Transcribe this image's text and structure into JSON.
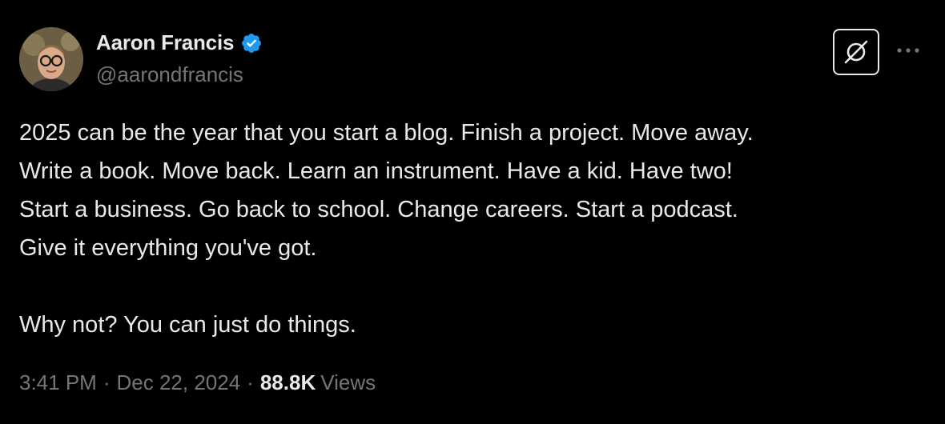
{
  "author": {
    "display_name": "Aaron Francis",
    "handle": "@aarondfrancis",
    "verified": true,
    "verified_color": "#1d9bf0"
  },
  "actions": {
    "grok_icon": "grok-icon",
    "more_icon": "more-horizontal-icon"
  },
  "tweet": {
    "lines": [
      "2025 can be the year that you start a blog. Finish a project. Move away.",
      "Write a book. Move back. Learn an instrument. Have a kid. Have two!",
      "Start a business. Go back to school. Change careers. Start a podcast.",
      "Give it everything you've got.",
      "Why not? You can just do things."
    ]
  },
  "meta": {
    "time": "3:41 PM",
    "separator": "·",
    "date": "Dec 22, 2024",
    "views_count": "88.8K",
    "views_label": "Views"
  },
  "colors": {
    "background": "#000000",
    "text_primary": "#e7e9ea",
    "text_secondary": "#71767b"
  }
}
